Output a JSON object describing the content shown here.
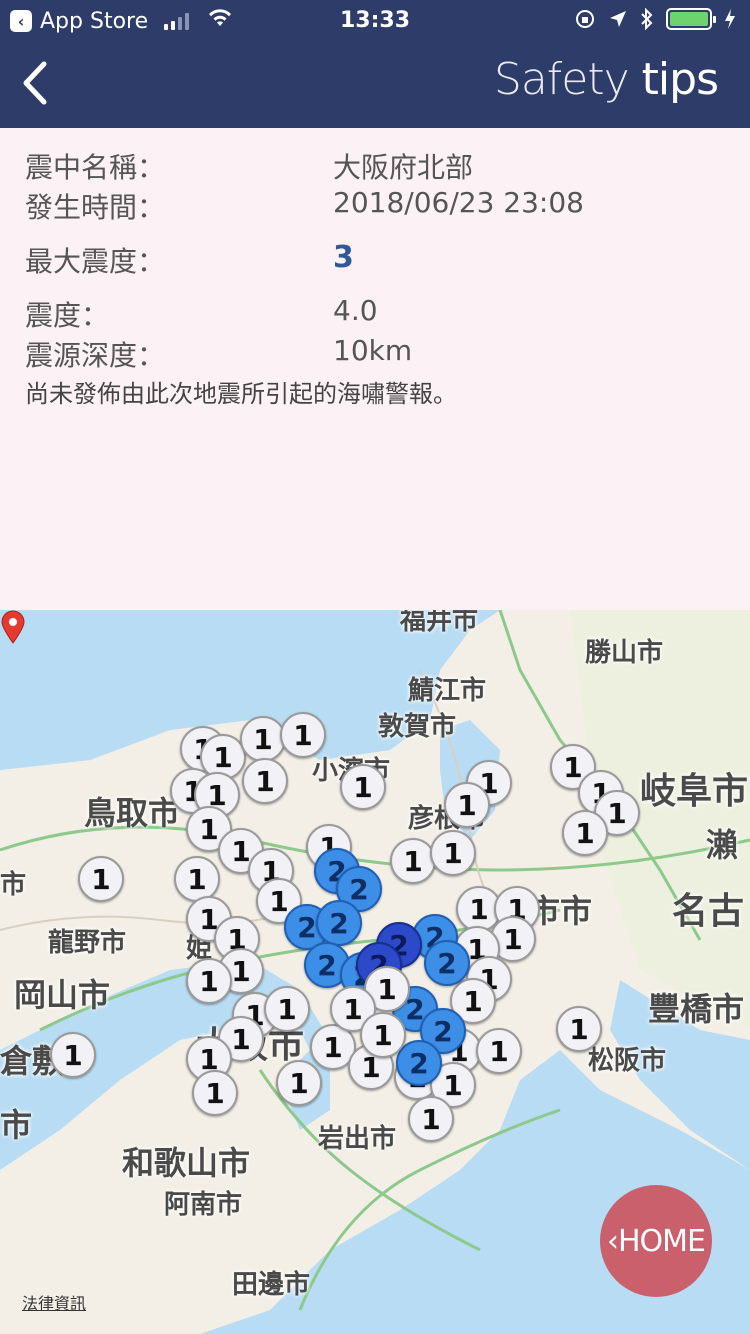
{
  "status_bar": {
    "back_app": "App Store",
    "time": "13:33"
  },
  "nav": {
    "title_light": "Safety",
    "title_bold": "tips"
  },
  "info": {
    "name_label": "震中名稱：",
    "name_value": "大阪府北部",
    "time_label": "發生時間：",
    "time_value": "2018/06/23 23:08",
    "max_intensity_label": "最大震度：",
    "max_intensity_value": "3",
    "magnitude_label": "震度：",
    "magnitude_value": "4.0",
    "depth_label": "震源深度：",
    "depth_value": "10km",
    "tsunami_note": "尚未發佈由此次地震所引起的海嘯警報。"
  },
  "map": {
    "labels": {
      "fukui": "福井市",
      "katsuyama": "勝山市",
      "sabae": "鯖江市",
      "tsuruga": "敦賀市",
      "obama": "小濱市",
      "gifu": "岐阜市",
      "tottori": "鳥取市",
      "hikone": "彦根市",
      "seki": "瀨",
      "tatsuno": "龍野市",
      "nagoya": "名古",
      "okayama": "岡山市",
      "toyohashi": "豐橋市",
      "kurashiki": "倉敷",
      "osaka": "大阪市",
      "matsusaka": "松阪市",
      "iwade": "岩出市",
      "wakayama": "和歌山市",
      "anan": "阿南市",
      "tanabe": "田邊市",
      "ichi": "市",
      "tsu": "市市",
      "himeji": "姫"
    },
    "legal": "法律資訊",
    "pin_text": "1",
    "pin_text_2": "2"
  },
  "home_label": "HOME"
}
